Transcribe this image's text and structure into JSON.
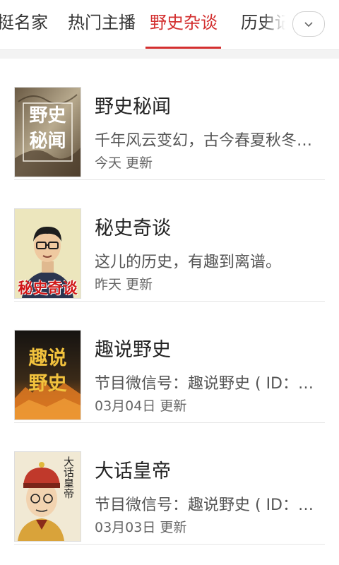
{
  "tabs": [
    {
      "label": "挺名家",
      "active": false
    },
    {
      "label": "热门主播",
      "active": false
    },
    {
      "label": "野史杂谈",
      "active": true
    },
    {
      "label": "历史记",
      "active": false
    }
  ],
  "more_icon": "chevron-down-icon",
  "accent_color": "#d32f2f",
  "items": [
    {
      "title": "野史秘闻",
      "desc": "千年风云变幻，古今春夏秋冬，尽…",
      "updated": "今天 更新",
      "cover_text": [
        "野史",
        "秘闻"
      ]
    },
    {
      "title": "秘史奇谈",
      "desc": "这儿的历史，有趣到离谱。",
      "updated": "昨天 更新",
      "cover_text": [
        "秘史",
        "奇谈"
      ]
    },
    {
      "title": "趣说野史",
      "desc": "节目微信号：趣说野史 ( ID：qush…",
      "updated": "03月04日 更新",
      "cover_text": [
        "趣说",
        "野史"
      ]
    },
    {
      "title": "大话皇帝",
      "desc": "节目微信号：趣说野史 ( ID：qush…",
      "updated": "03月03日 更新",
      "cover_text": [
        "大话皇帝"
      ]
    }
  ]
}
